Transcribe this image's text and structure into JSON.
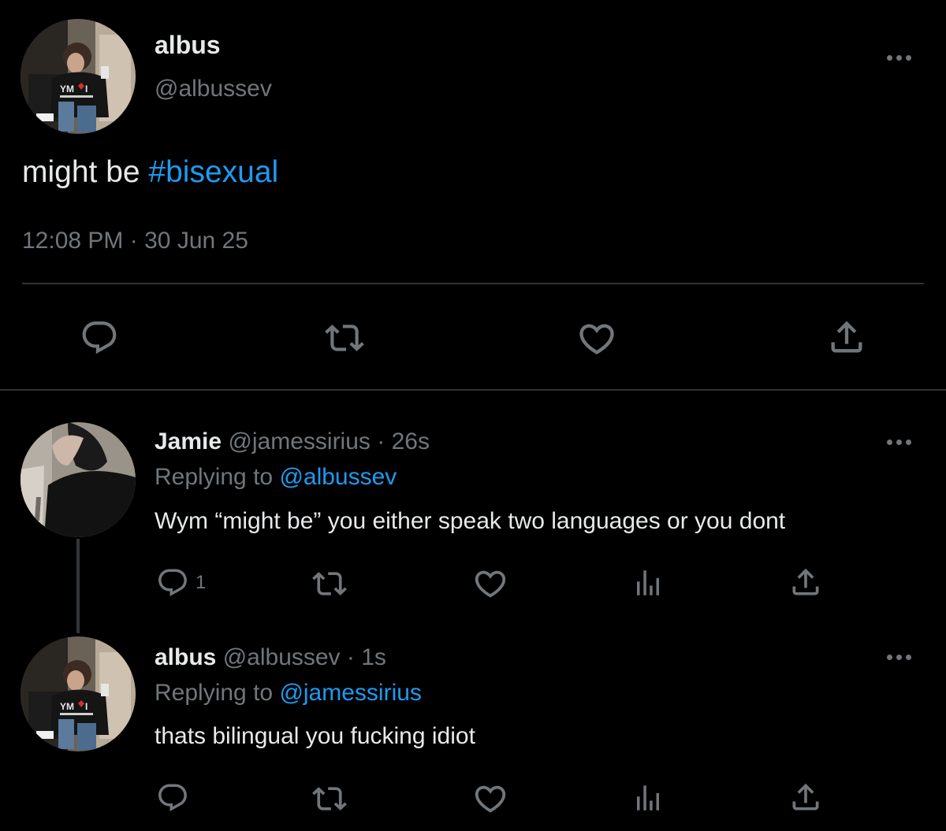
{
  "main_tweet": {
    "display_name": "albus",
    "handle": "@albussev",
    "text_prefix": "might be ",
    "hashtag": "#bisexual",
    "time": "12:08 PM",
    "sep": "·",
    "date": "30 Jun 25"
  },
  "reply1": {
    "display_name": "Jamie",
    "handle": "@jamessirius",
    "sep": "·",
    "age": "26s",
    "replying_label": "Replying to",
    "replying_handle": "@albussev",
    "text": "Wym “might be” you either speak two languages or you dont",
    "reply_count": "1"
  },
  "reply2": {
    "display_name": "albus",
    "handle": "@albussev",
    "sep": "·",
    "age": "1s",
    "replying_label": "Replying to",
    "replying_handle": "@jamessirius",
    "text": "thats bilingual you fucking idiot"
  },
  "icons": [
    "reply-icon",
    "retweet-icon",
    "like-icon",
    "views-icon",
    "share-icon",
    "more-icon"
  ],
  "colors": {
    "background": "#000000",
    "text": "#e7e9ea",
    "muted": "#71767b",
    "link": "#1d9bf0",
    "divider": "#2f3336"
  }
}
